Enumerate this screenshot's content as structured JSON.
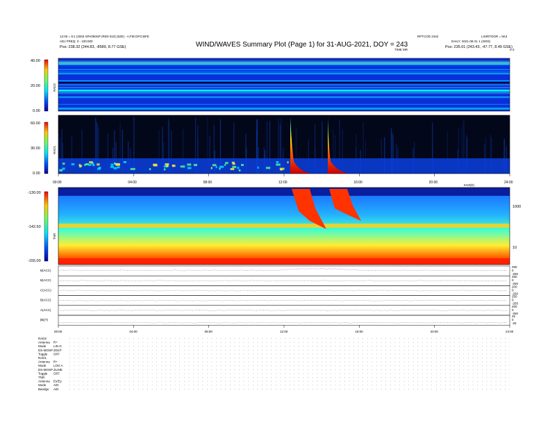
{
  "title": "WIND/WAVES Summary Plot (Page 1) for 31-AUG-2021, DOY = 243",
  "header": {
    "left_line1": "12:00 = 9:1 (2003 SPA050SP (RD0 010) (52E) - A:FIE:DFG:BFE",
    "left_line2": "ADJ FREQ: 3 - 100:000",
    "left_pos": "Pos:  238.32 (244.83, -8589, 8.77 GSE)",
    "mid_right": "RPTCOD 2442",
    "right_line1": "LISIRTOOR = 5K3",
    "right_line2": "DAILY: 2021-08-31 1 (2003)",
    "right_pos": "Pos:  235.01 (243.43, -47.77, 8.49 GSE)",
    "tick_title": "TIME MR",
    "corner": "0-3"
  },
  "colorbar_labels": {
    "rad2": [
      "40.00",
      "20.00",
      "0.00"
    ],
    "rad1": [
      "60.00",
      "30.00",
      "0.00"
    ],
    "tnr": [
      "-130.00",
      "-142.50",
      "-155.00"
    ]
  },
  "panel_names": {
    "rad2": "RAD2",
    "rad1": "RAD1",
    "tnr": "TNR"
  },
  "right_axis": {
    "label_1000": "1000",
    "label_10": "10",
    "unit": "KHZ(E)"
  },
  "time_ticks": [
    "00:00",
    "04:00",
    "08:00",
    "12:00",
    "16:00",
    "20:00",
    "24:00"
  ],
  "bottom_ticks": [
    "00:00",
    "04:00",
    "08:00",
    "12:00",
    "16:00",
    "20:00",
    "24:00"
  ],
  "mag_panels": [
    {
      "label": "B(ACC)",
      "ticks": [
        "250",
        "0",
        "-250"
      ]
    },
    {
      "label": "B(ACC)",
      "ticks": [
        "250",
        "0",
        "-250"
      ]
    },
    {
      "label": "C(ACC)",
      "ticks": [
        "200",
        "0",
        "-250"
      ]
    },
    {
      "label": "B(ACC)",
      "ticks": [
        "250",
        "0",
        "-250"
      ]
    },
    {
      "label": "A(ACC)",
      "ticks": [
        "200",
        "0",
        "-250"
      ]
    },
    {
      "label": "|B|(T)",
      "ticks": [
        "25",
        "0",
        "-25"
      ]
    }
  ],
  "config_rows": [
    [
      "RAD2",
      ""
    ],
    [
      "Antenna",
      "R+"
    ],
    [
      "Mode",
      "LIN G"
    ],
    [
      "DS-MOSP",
      "ZDST"
    ],
    [
      "Toggle",
      "OFF"
    ],
    [
      "RAD1",
      ""
    ],
    [
      "Antenna",
      "R+"
    ],
    [
      "Mode",
      "LOG A"
    ],
    [
      "DS-MOSP",
      "ZLINE"
    ],
    [
      "Toggle",
      "OFF"
    ],
    [
      "TNR",
      ""
    ],
    [
      "Antenna",
      "Ex/Ey"
    ],
    [
      "Mode",
      "A/D"
    ],
    [
      "Bandgs",
      "A/D"
    ]
  ],
  "chart_data": {
    "type": "heatmap",
    "title": "WIND/WAVES Summary Plot (Page 1) for 31-AUG-2021, DOY = 243",
    "x_range_hours": [
      0,
      24
    ],
    "panels": [
      {
        "name": "RAD2",
        "colorbar_range": [
          0,
          40
        ],
        "notes": "mostly blue background, horizontal interference lines"
      },
      {
        "name": "RAD1",
        "colorbar_range": [
          0,
          60
        ],
        "bursts_hours": [
          12.6,
          14.6
        ],
        "notes": "type III radio bursts near 12:40 and 14:40"
      },
      {
        "name": "TNR",
        "colorbar_range": [
          -155,
          -130
        ],
        "bursts_hours": [
          12.6,
          14.6
        ],
        "notes": "plasma line near 30 kHz"
      }
    ],
    "colormap": [
      "#000000",
      "#0000aa",
      "#0000ff",
      "#0077ff",
      "#00e5ff",
      "#33ff99",
      "#ffff00",
      "#ff8800",
      "#ff0000",
      "#aa0000"
    ]
  }
}
